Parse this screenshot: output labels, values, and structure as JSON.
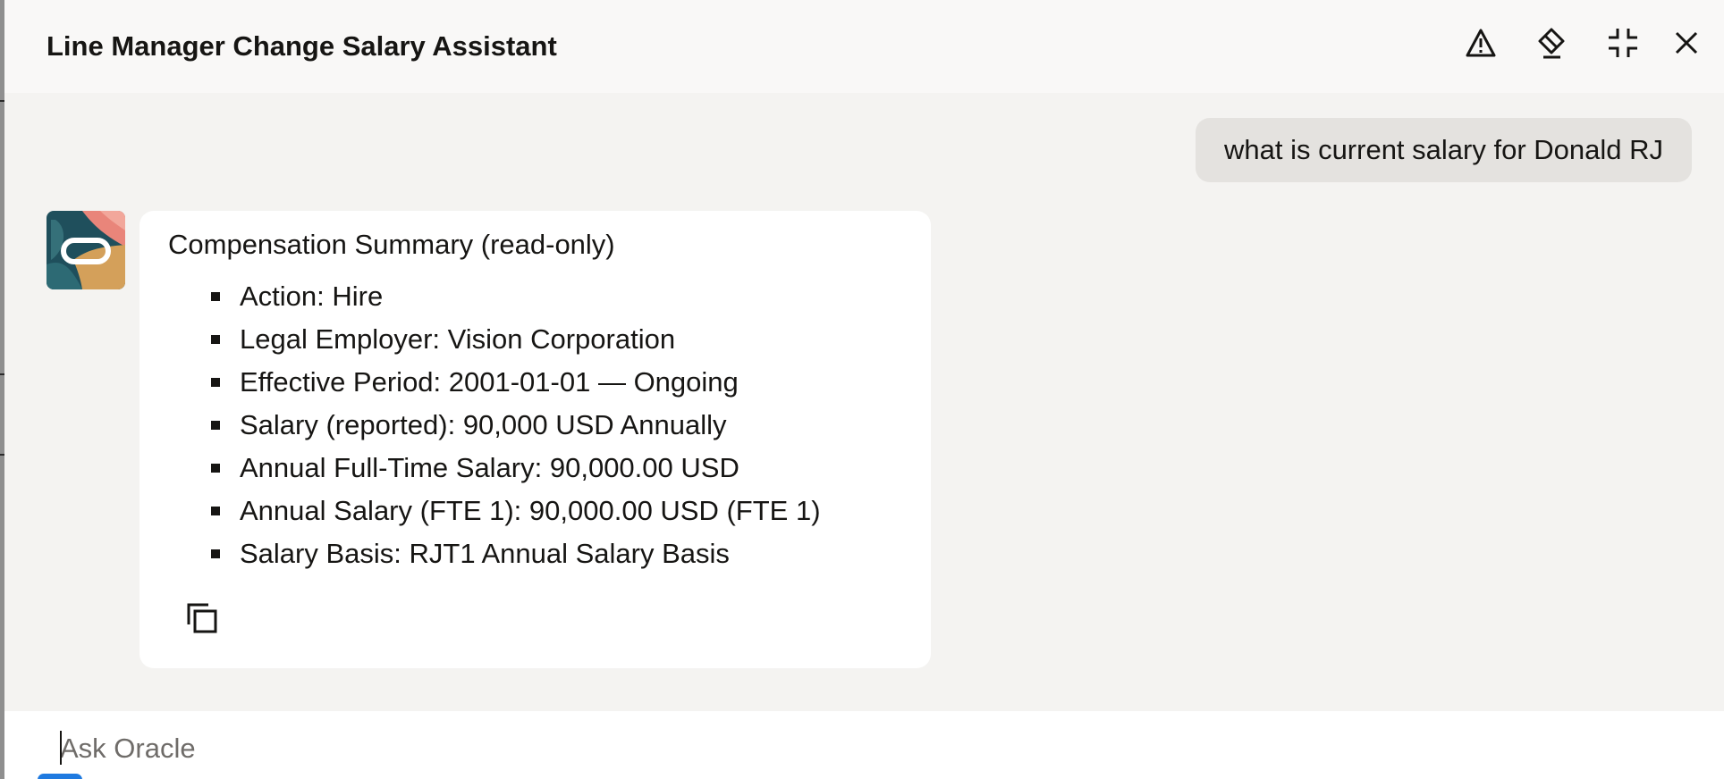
{
  "window": {
    "title": "Line Manager Change Salary Assistant",
    "actions": [
      {
        "name": "report-issue",
        "icon": "warning-triangle-icon"
      },
      {
        "name": "clear-chat",
        "icon": "eraser-icon"
      },
      {
        "name": "minimize",
        "icon": "collapse-icon"
      },
      {
        "name": "close",
        "icon": "close-icon"
      }
    ]
  },
  "conversation": {
    "user_message": "what is current salary for Donald RJ",
    "assistant": {
      "avatar_icon": "oracle-logo-icon",
      "heading": "Compensation Summary (read-only)",
      "items": [
        "Action: Hire",
        "Legal Employer: Vision Corporation",
        "Effective Period: 2001-01-01 — Ongoing",
        "Salary (reported): 90,000 USD Annually",
        "Annual Full-Time Salary: 90,000.00 USD",
        "Annual Salary (FTE 1): 90,000.00 USD (FTE 1)",
        "Salary Basis: RJT1 Annual Salary Basis"
      ],
      "copy_icon": "copy-icon"
    }
  },
  "composer": {
    "placeholder": "Ask Oracle",
    "value": ""
  },
  "colors": {
    "header_bg": "#f9f8f7",
    "chat_bg": "#f4f3f1",
    "user_bubble_bg": "#e4e2df",
    "card_bg": "#ffffff",
    "text": "#161513",
    "accent": "#1f7ae0"
  }
}
